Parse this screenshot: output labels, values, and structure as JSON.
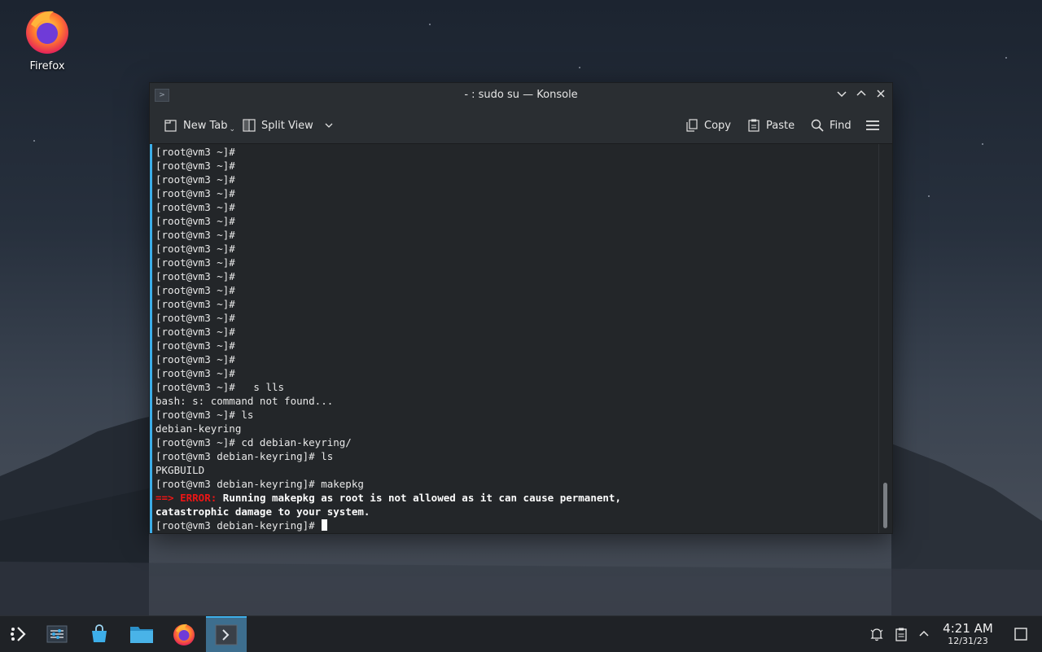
{
  "desktop": {
    "icons": [
      {
        "label": "Firefox",
        "icon": "firefox-icon"
      }
    ]
  },
  "window": {
    "title": "- : sudo su — Konsole",
    "controls": {
      "minimize": "minimize-icon",
      "maximize": "maximize-icon",
      "close": "close-icon"
    },
    "toolbar": {
      "new_tab": "New Tab",
      "split_view": "Split View",
      "copy": "Copy",
      "paste": "Paste",
      "find": "Find",
      "menu": "hamburger-menu-icon"
    }
  },
  "terminal": {
    "lines": [
      "[root@vm3 ~]#",
      "[root@vm3 ~]#",
      "[root@vm3 ~]#",
      "[root@vm3 ~]#",
      "[root@vm3 ~]#",
      "[root@vm3 ~]#",
      "[root@vm3 ~]#",
      "[root@vm3 ~]#",
      "[root@vm3 ~]#",
      "[root@vm3 ~]#",
      "[root@vm3 ~]#",
      "[root@vm3 ~]#",
      "[root@vm3 ~]#",
      "[root@vm3 ~]#",
      "[root@vm3 ~]#",
      "[root@vm3 ~]#",
      "[root@vm3 ~]#",
      "[root@vm3 ~]#   s lls",
      "bash: s: command not found...",
      "[root@vm3 ~]# ls",
      "debian-keyring",
      "[root@vm3 ~]# cd debian-keyring/",
      "[root@vm3 debian-keyring]# ls",
      "PKGBUILD",
      "[root@vm3 debian-keyring]# makepkg"
    ],
    "error": {
      "arrow": "==>",
      "label": "ERROR:",
      "message_1": "Running makepkg as root is not allowed as it can cause permanent,",
      "message_2": "catastrophic damage to your system."
    },
    "prompt": "[root@vm3 debian-keyring]#"
  },
  "taskbar": {
    "launcher": "app-launcher-icon",
    "items": [
      "system-settings-icon",
      "discover-store-icon",
      "file-manager-icon",
      "firefox-icon",
      "konsole-icon"
    ],
    "tray": [
      "notifications-icon",
      "clipboard-icon",
      "tray-expand-icon"
    ],
    "clock": {
      "time": "4:21 AM",
      "date": "12/31/23"
    },
    "show_desktop": "show-desktop-icon"
  },
  "colors": {
    "accent": "#3daee9",
    "error": "#ed1515",
    "terminal_bg": "#232629"
  }
}
